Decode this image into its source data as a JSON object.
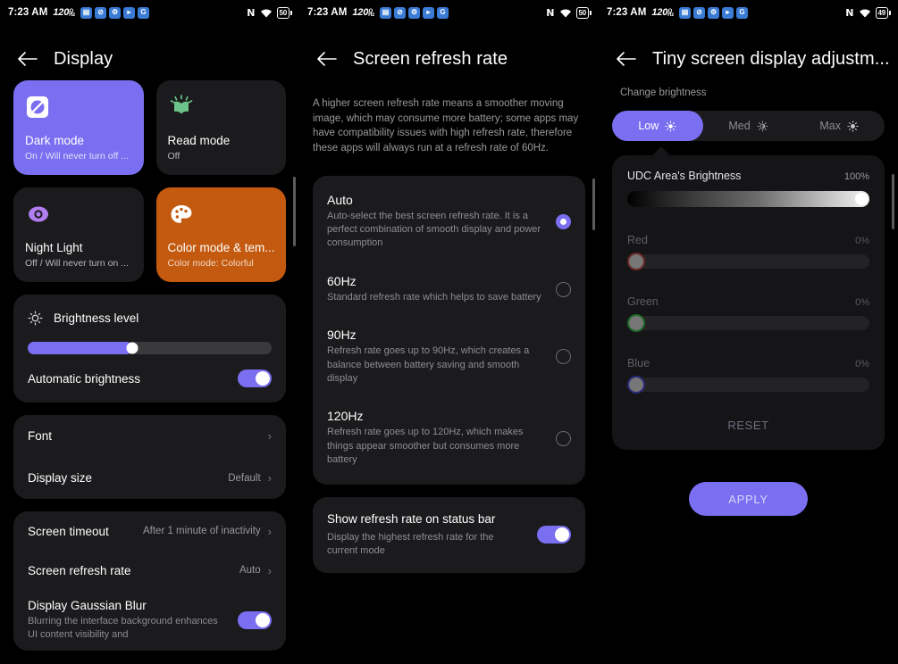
{
  "statusbar": {
    "time": "7:23 AM",
    "refresh_rate": "120",
    "refresh_unit_top": "O",
    "refresh_unit_bottom": "Hz",
    "app_icons": [
      "sim-icon",
      "no-sound-icon",
      "gear-icon",
      "play-store-icon",
      "google-icon"
    ],
    "nfc": "N",
    "wifi": "wifi-icon",
    "battery_1": "50",
    "battery_2": "50",
    "battery_3": "49"
  },
  "screen1": {
    "title": "Display",
    "back": "back-arrow",
    "tiles": [
      {
        "title": "Dark mode",
        "sub": "On / Will never turn off ...",
        "icon": "dark-mode-icon",
        "style": "purple"
      },
      {
        "title": "Read mode",
        "sub": "Off",
        "icon": "read-mode-icon",
        "style": "dark"
      },
      {
        "title": "Night Light",
        "sub": "Off / Will never turn on ...",
        "icon": "night-light-icon",
        "style": "dark"
      },
      {
        "title": "Color mode & tem...",
        "sub": "Color mode: Colorful",
        "icon": "palette-icon",
        "style": "orange"
      }
    ],
    "brightness": {
      "label": "Brightness level",
      "icon": "brightness-icon",
      "value_percent": 43,
      "auto_label": "Automatic brightness",
      "auto_on": true
    },
    "rows": [
      {
        "label": "Font",
        "value": ""
      },
      {
        "label": "Display size",
        "value": "Default"
      }
    ],
    "rows2": [
      {
        "label": "Screen timeout",
        "value": "After 1 minute of inactivity"
      },
      {
        "label": "Screen refresh rate",
        "value": "Auto"
      }
    ],
    "gaussian": {
      "title": "Display Gaussian Blur",
      "desc": "Blurring the interface background enhances UI content visibility and",
      "on": true
    }
  },
  "screen2": {
    "title": "Screen refresh rate",
    "description": "A higher screen refresh rate means a smoother moving image, which may consume more battery; some apps may have compatibility issues with high refresh rate, therefore these apps will always run at a refresh rate of 60Hz.",
    "options": [
      {
        "title": "Auto",
        "desc": "Auto-select the best screen refresh rate. It is a perfect combination of smooth display and power consumption",
        "selected": true
      },
      {
        "title": "60Hz",
        "desc": "Standard refresh rate which helps to save battery",
        "selected": false
      },
      {
        "title": "90Hz",
        "desc": "Refresh rate goes up to 90Hz, which creates a balance between battery saving and smooth display",
        "selected": false
      },
      {
        "title": "120Hz",
        "desc": "Refresh rate goes up to 120Hz, which makes things appear smoother but consumes more battery",
        "selected": false
      }
    ],
    "show_on_status_bar": {
      "title": "Show refresh rate on status bar",
      "desc": "Display the highest refresh rate for the current mode",
      "on": true
    }
  },
  "screen3": {
    "title": "Tiny screen display adjustm...",
    "sub_label": "Change brightness",
    "segments": [
      {
        "label": "Low",
        "icon": "brightness-low-icon",
        "active": true
      },
      {
        "label": "Med",
        "icon": "brightness-med-icon",
        "active": false
      },
      {
        "label": "Max",
        "icon": "brightness-max-icon",
        "active": false
      }
    ],
    "udc": {
      "label": "UDC Area's Brightness",
      "value": "100%"
    },
    "channels": [
      {
        "label": "Red",
        "value": "0%"
      },
      {
        "label": "Green",
        "value": "0%"
      },
      {
        "label": "Blue",
        "value": "0%"
      }
    ],
    "reset_label": "RESET",
    "apply_label": "APPLY"
  },
  "colors": {
    "accent": "#7a6ff0",
    "card": "#1b1b1d",
    "orange_tile": "#c35a10",
    "read_mode_green": "#6cc48a",
    "night_light_purple": "#b07ef0",
    "background": "#000000"
  }
}
